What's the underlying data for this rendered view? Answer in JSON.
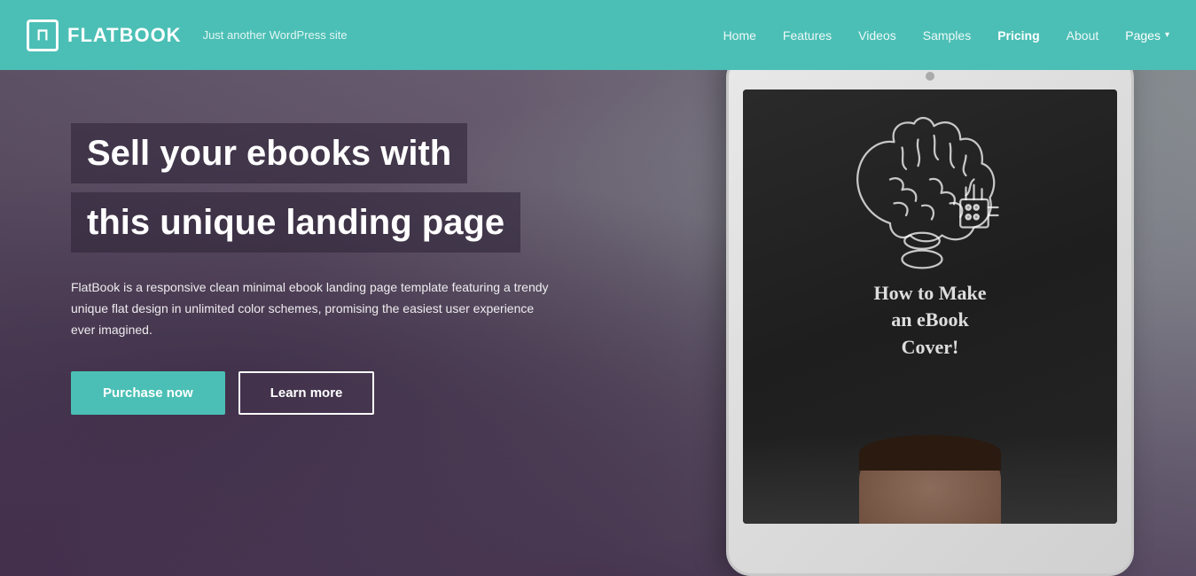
{
  "header": {
    "logo_icon": "⊓",
    "logo_text": "FLATBOOK",
    "tagline": "Just another WordPress site",
    "nav": {
      "items": [
        {
          "label": "Home",
          "active": false
        },
        {
          "label": "Features",
          "active": false
        },
        {
          "label": "Videos",
          "active": false
        },
        {
          "label": "Samples",
          "active": false
        },
        {
          "label": "Pricing",
          "active": true
        },
        {
          "label": "About",
          "active": false
        }
      ],
      "pages_label": "Pages",
      "pages_dropdown_arrow": "▾"
    }
  },
  "hero": {
    "title_line1": "Sell your ebooks with",
    "title_line2": "this unique landing page",
    "description": "FlatBook is a responsive clean minimal ebook landing page template featuring a trendy unique flat design in unlimited color schemes, promising the easiest user experience ever imagined.",
    "purchase_label": "Purchase now",
    "learn_label": "Learn more"
  },
  "tablet": {
    "ebook_title_line1": "How to Make",
    "ebook_title_line2": "an eBook",
    "ebook_title_line3": "Cover!"
  },
  "colors": {
    "accent": "#4BBFB5",
    "header_bg": "#4BBFB5"
  }
}
